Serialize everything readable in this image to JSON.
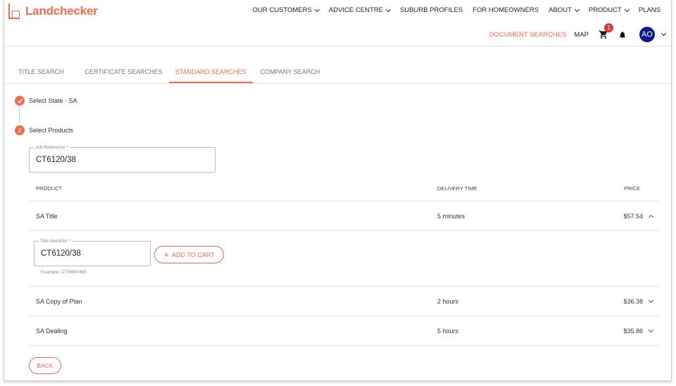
{
  "brand": {
    "name": "Landchecker",
    "accent": "#f26c4f",
    "avatar_bg": "#0d1a8a"
  },
  "topnav": [
    {
      "label": "OUR CUSTOMERS",
      "dropdown": true
    },
    {
      "label": "ADVICE CENTRE",
      "dropdown": true
    },
    {
      "label": "SUBURB PROFILES",
      "dropdown": false
    },
    {
      "label": "FOR HOMEOWNERS",
      "dropdown": false
    },
    {
      "label": "ABOUT",
      "dropdown": true
    },
    {
      "label": "PRODUCT",
      "dropdown": true
    },
    {
      "label": "PLANS",
      "dropdown": false
    }
  ],
  "subnav": {
    "document_searches": "DOCUMENT SEARCHES",
    "map": "MAP",
    "cart_count": "1",
    "cart_icon": "shopping-cart-icon",
    "bell_icon": "bell-icon",
    "avatar_initials": "AO"
  },
  "tabs": {
    "title_search": "TITLE SEARCH",
    "certificate_searches": "CERTIFICATE SEARCHES",
    "standard_searches": "STANDARD SEARCHES",
    "company_search": "COMPANY SEARCH",
    "active": "standard_searches"
  },
  "steps": {
    "step1": {
      "label": "Select State - SA",
      "icon": "check-icon"
    },
    "step2": {
      "number": "2",
      "label": "Select Products"
    }
  },
  "job_reference": {
    "legend": "Job Reference *",
    "value": "CT6120/38"
  },
  "table": {
    "headers": {
      "product": "PRODUCT",
      "delivery": "DELIVERY TIME",
      "price": "PRICE"
    },
    "rows": [
      {
        "product": "SA Title",
        "delivery": "5 minutes",
        "price": "$57.54",
        "expanded": true
      },
      {
        "product": "SA Copy of Plan",
        "delivery": "2 hours",
        "price": "$36.38",
        "expanded": false
      },
      {
        "product": "SA Dealing",
        "delivery": "5 hours",
        "price": "$35.86",
        "expanded": false
      }
    ]
  },
  "title_identifier": {
    "legend": "Title Identifier *",
    "value": "CT6120/38",
    "example": "Example: CT5685/463",
    "add_to_cart": "ADD TO CART"
  },
  "back_label": "BACK"
}
